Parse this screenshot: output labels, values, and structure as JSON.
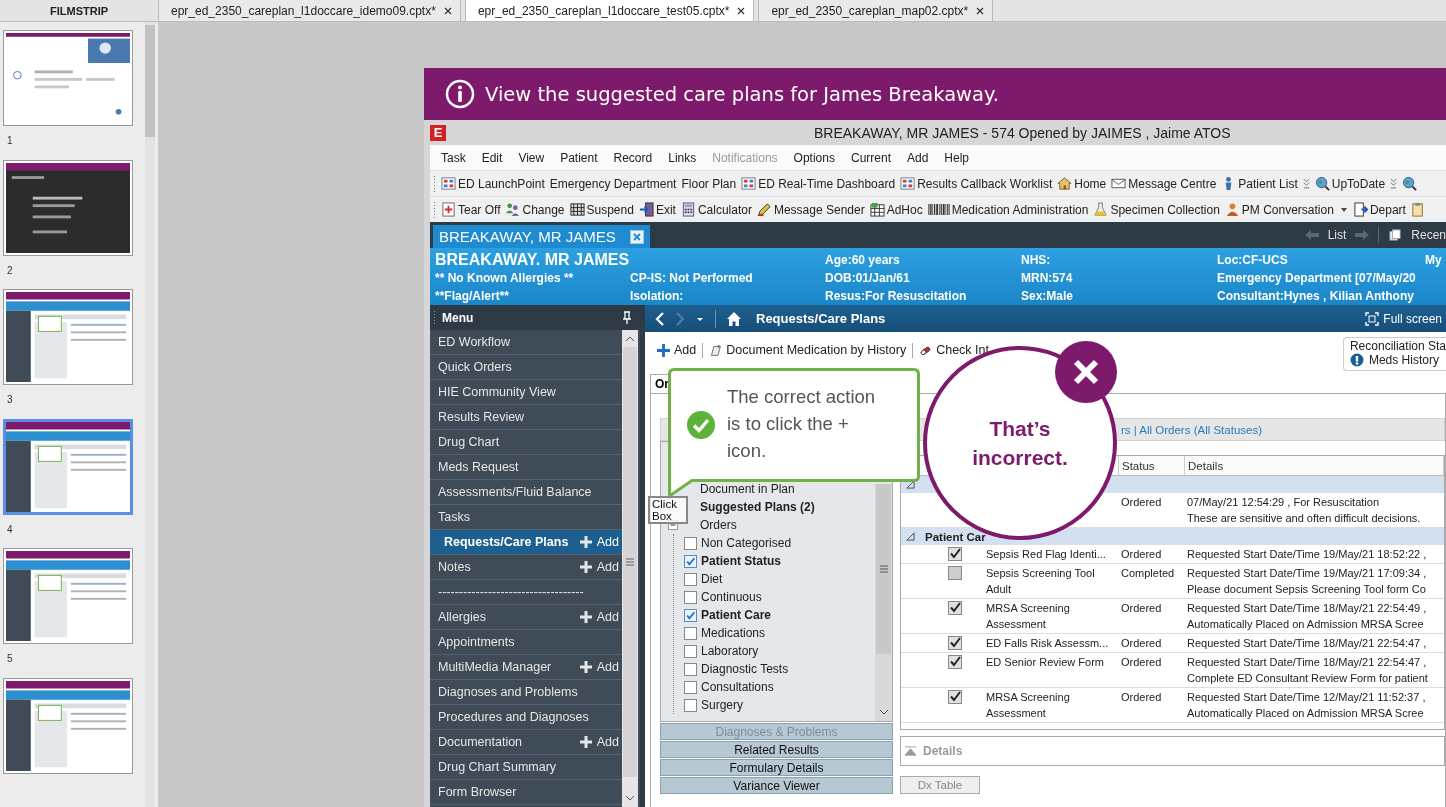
{
  "filmstrip": {
    "title": "FILMSTRIP",
    "slides": [
      {
        "number": "1",
        "selected": false
      },
      {
        "number": "2",
        "selected": false
      },
      {
        "number": "3",
        "selected": false
      },
      {
        "number": "4",
        "selected": true
      },
      {
        "number": "5",
        "selected": false
      },
      {
        "selected": false
      }
    ]
  },
  "file_tabs": [
    {
      "label": "epr_ed_2350_careplan_l1doccare_idemo09.cptx*",
      "selected": false
    },
    {
      "label": "epr_ed_2350_careplan_l1doccare_test05.cptx*",
      "selected": true
    },
    {
      "label": "epr_ed_2350_careplan_map02.cptx*",
      "selected": false
    }
  ],
  "slide": {
    "banner": "View the suggested care plans for James Breakaway.",
    "window": {
      "icon_letter": "E",
      "title": "BREAKAWAY, MR JAMES - 574 Opened by JAIMES , Jaime ATOS"
    },
    "menu": [
      {
        "label": "Task",
        "disabled": false
      },
      {
        "label": "Edit",
        "disabled": false
      },
      {
        "label": "View",
        "disabled": false
      },
      {
        "label": "Patient",
        "disabled": false
      },
      {
        "label": "Record",
        "disabled": false
      },
      {
        "label": "Links",
        "disabled": false
      },
      {
        "label": "Notifications",
        "disabled": true
      },
      {
        "label": "Options",
        "disabled": false
      },
      {
        "label": "Current",
        "disabled": false
      },
      {
        "label": "Add",
        "disabled": false
      },
      {
        "label": "Help",
        "disabled": false
      }
    ],
    "toolbar_1": [
      {
        "label": "ED LaunchPoint",
        "kind": "grid"
      },
      {
        "label": "Emergency Department",
        "kind": "text"
      },
      {
        "label": "Floor Plan",
        "kind": "text"
      },
      {
        "label": "ED Real-Time Dashboard",
        "kind": "grid"
      },
      {
        "label": "Results Callback Worklist",
        "kind": "grid"
      },
      {
        "label": "Home",
        "kind": "house"
      },
      {
        "label": "Message Centre",
        "kind": "envelope"
      },
      {
        "label": "Patient List",
        "kind": "person"
      },
      {
        "kind": "overflow"
      },
      {
        "label": "UpToDate",
        "kind": "globe"
      },
      {
        "kind": "overflow"
      },
      {
        "kind": "globe"
      }
    ],
    "toolbar_2": [
      {
        "label": "Tear Off",
        "kind": "tearoff"
      },
      {
        "label": "Change",
        "kind": "people"
      },
      {
        "label": "Suspend",
        "kind": "suspend"
      },
      {
        "label": "Exit",
        "kind": "exit"
      },
      {
        "label": "Calculator",
        "kind": "calc"
      },
      {
        "label": "Message Sender",
        "kind": "pen"
      },
      {
        "label": "AdHoc",
        "kind": "adhoc"
      },
      {
        "label": "Medication Administration",
        "kind": "barcode"
      },
      {
        "label": "Specimen Collection",
        "kind": "flask"
      },
      {
        "label": "PM Conversation",
        "kind": "person_menu"
      },
      {
        "label": "Depart",
        "kind": "door"
      },
      {
        "kind": "clipboard"
      }
    ],
    "patient_tab": {
      "label": "BREAKAWAY, MR JAMES"
    },
    "tab_bar_right": [
      "List",
      "Recen"
    ],
    "patient_banner": {
      "name": "BREAKAWAY. MR JAMES",
      "columns": [
        [
          "** No Known Allergies **",
          "**Flag/Alert**"
        ],
        [
          "CP-IS: Not Performed",
          "Isolation:"
        ],
        [
          "Age:60 years",
          "DOB:01/Jan/61",
          "Resus:For Resuscitation"
        ],
        [
          "NHS:",
          "MRN:574",
          "Sex:Male"
        ],
        [
          "Loc:CF-UCS",
          "Emergency Department [07/May/20",
          "Consultant:Hynes , Kilian Anthony"
        ],
        [
          "My"
        ]
      ]
    },
    "left_menu": {
      "title": "Menu",
      "items": [
        {
          "label": "ED Workflow",
          "selected": false
        },
        {
          "label": "Quick Orders",
          "selected": false
        },
        {
          "label": "HIE Community View",
          "selected": false
        },
        {
          "label": "Results Review",
          "selected": false
        },
        {
          "label": "Drug Chart",
          "selected": false
        },
        {
          "label": "Meds Request",
          "selected": false
        },
        {
          "label": "Assessments/Fluid Balance",
          "selected": false
        },
        {
          "label": "Tasks",
          "selected": false
        },
        {
          "label": "Requests/Care Plans",
          "selected": true,
          "add": "Add"
        },
        {
          "label": "Notes",
          "selected": false,
          "add": "Add"
        },
        {
          "label": "-----------------------------------",
          "selected": false
        },
        {
          "label": "Allergies",
          "selected": false,
          "add": "Add"
        },
        {
          "label": "Appointments",
          "selected": false
        },
        {
          "label": "MultiMedia Manager",
          "selected": false,
          "add": "Add"
        },
        {
          "label": "Diagnoses and Problems",
          "selected": false
        },
        {
          "label": "Procedures and Diagnoses",
          "selected": false
        },
        {
          "label": "Documentation",
          "selected": false,
          "add": "Add"
        },
        {
          "label": "Drug Chart Summary",
          "selected": false
        },
        {
          "label": "Form Browser",
          "selected": false
        }
      ]
    },
    "content": {
      "title": "Requests/Care Plans",
      "full_screen": "Full screen",
      "actions": [
        {
          "label": "Add",
          "kind": "plus"
        },
        {
          "label": "Document Medication by History",
          "kind": "scroll"
        },
        {
          "label": "Check Int",
          "kind": "pill"
        }
      ],
      "reconciliation": {
        "title": "Reconciliation Sta",
        "item": "Meds History"
      },
      "orders": {
        "tab": "Or",
        "filter": "rs | All Orders (All Statuses)",
        "tree": [
          {
            "label": "Document in Plan",
            "kind": "item"
          },
          {
            "label": "Suggested Plans (2)",
            "kind": "heading"
          },
          {
            "label": "Orders",
            "kind": "folder",
            "expanded": true,
            "children": [
              {
                "label": "Non Categorised",
                "checked": false
              },
              {
                "label": "Patient Status",
                "checked": true
              },
              {
                "label": "Diet",
                "checked": false
              },
              {
                "label": "Continuous",
                "checked": false
              },
              {
                "label": "Patient Care",
                "checked": true
              },
              {
                "label": "Medications",
                "checked": false
              },
              {
                "label": "Laboratory",
                "checked": false
              },
              {
                "label": "Diagnostic Tests",
                "checked": false
              },
              {
                "label": "Consultations",
                "checked": false
              },
              {
                "label": "Surgery",
                "checked": false
              }
            ]
          }
        ],
        "tree_buttons": [
          {
            "label": "Diagnoses & Problems",
            "disabled": true
          },
          {
            "label": "Related Results",
            "disabled": false
          },
          {
            "label": "Formulary Details",
            "disabled": false
          },
          {
            "label": "Variance Viewer",
            "disabled": false
          }
        ],
        "table": {
          "columns": [
            "Status",
            "Details"
          ],
          "rows": [
            {
              "kind": "group",
              "expanded": true
            },
            {
              "kind": "order",
              "status": "Ordered",
              "details": [
                "07/May/21 12:54:29 , For Resuscitation",
                "These are sensitive and often difficult decisions."
              ]
            },
            {
              "kind": "group",
              "label": "Patient Car",
              "expanded": true
            },
            {
              "kind": "order",
              "checked": true,
              "name": "Sepsis Red Flag Identi...",
              "status": "Ordered",
              "details": [
                "Requested Start Date/Time 19/May/21 18:52:22 ,"
              ]
            },
            {
              "kind": "order",
              "checked": false,
              "name": "Sepsis Screening Tool Adult",
              "status": "Completed",
              "details": [
                "Requested Start Date/Time 19/May/21 17:09:34 ,",
                "Please document Sepsis Screening Tool form Co"
              ]
            },
            {
              "kind": "order",
              "checked": true,
              "name": "MRSA Screening Assessment",
              "status": "Ordered",
              "details": [
                "Requested Start Date/Time 18/May/21 22:54:49 ,",
                "Automatically Placed on Admission  MRSA Scree"
              ]
            },
            {
              "kind": "order",
              "checked": true,
              "name": "ED Falls Risk Assessm...",
              "status": "Ordered",
              "details": [
                "Requested Start Date/Time 18/May/21 22:54:47 ,"
              ]
            },
            {
              "kind": "order",
              "checked": true,
              "name": "ED Senior Review Form",
              "status": "Ordered",
              "details": [
                "Requested Start Date/Time 18/May/21 22:54:47 ,",
                "Complete ED Consultant Review Form for patient"
              ]
            },
            {
              "kind": "order",
              "checked": true,
              "name": "MRSA Screening Assessment",
              "status": "Ordered",
              "details": [
                "Requested Start Date/Time 12/May/21 11:52:37 ,",
                "Automatically Placed on Admission  MRSA Scree"
              ]
            }
          ]
        },
        "details_pane": "Details",
        "dx_table": "Dx Table"
      }
    },
    "callout": {
      "text": "The correct action is to click the + icon."
    },
    "feedback": {
      "text": "That’s incorrect."
    },
    "click_box": {
      "text": "Click Box"
    }
  }
}
